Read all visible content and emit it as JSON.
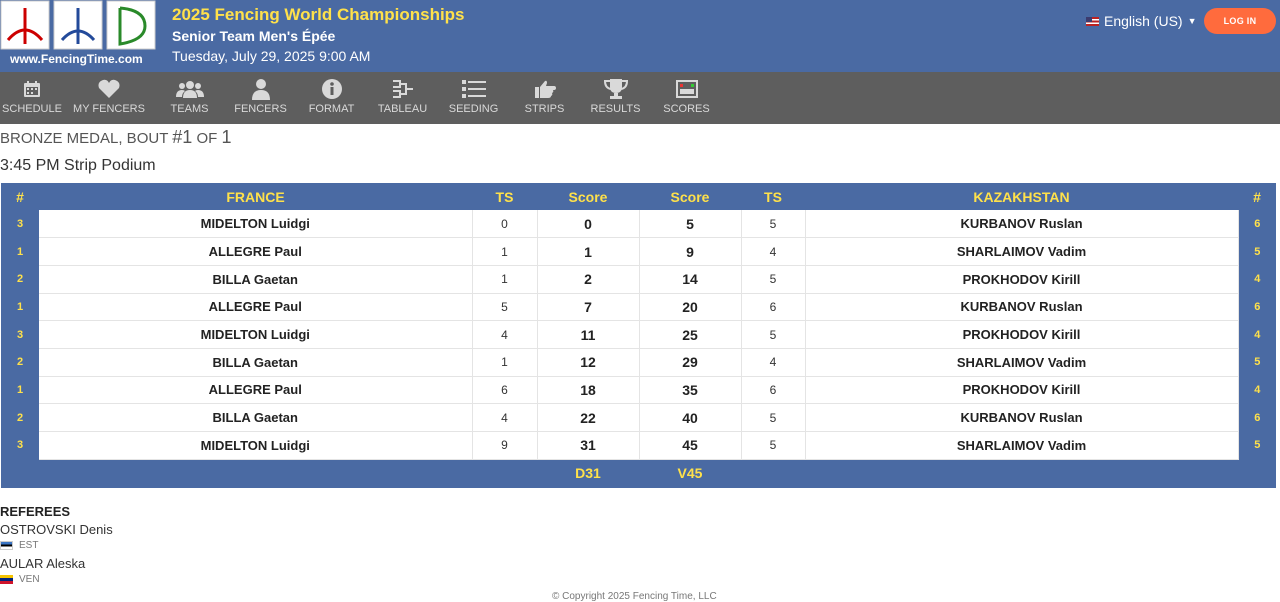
{
  "header": {
    "logo_url": "www.FencingTime.com",
    "title": "2025 Fencing World Championships",
    "subtitle": "Senior Team Men's Épée",
    "date": "Tuesday, July 29, 2025 9:00 AM",
    "language": "English (US)",
    "login_label": "LOG IN"
  },
  "nav": [
    {
      "label": "Schedule",
      "icon": "calendar-icon"
    },
    {
      "label": "My Fencers",
      "icon": "heart-icon"
    },
    {
      "label": "Teams",
      "icon": "group-icon"
    },
    {
      "label": "Fencers",
      "icon": "person-icon"
    },
    {
      "label": "Format",
      "icon": "info-icon"
    },
    {
      "label": "Tableau",
      "icon": "bracket-icon"
    },
    {
      "label": "Seeding",
      "icon": "list-icon"
    },
    {
      "label": "Strips",
      "icon": "pointing-hand-icon"
    },
    {
      "label": "Results",
      "icon": "trophy-icon"
    },
    {
      "label": "Scores",
      "icon": "scoreboard-icon"
    }
  ],
  "bout": {
    "prefix": "Bronze Medal, Bout ",
    "number": "#1",
    "of": " of ",
    "total": "1",
    "strip": "3:45 PM Strip Podium"
  },
  "table": {
    "headers": {
      "num_left": "#",
      "team_left": "FRANCE",
      "ts_left": "TS",
      "score_left": "Score",
      "score_right": "Score",
      "ts_right": "TS",
      "team_right": "KAZAKHSTAN",
      "num_right": "#"
    },
    "rows": [
      {
        "ln": "3",
        "lname": "MIDELTON Luidgi",
        "lts": "0",
        "lsc": "0",
        "rsc": "5",
        "rts": "5",
        "rname": "KURBANOV Ruslan",
        "rn": "6"
      },
      {
        "ln": "1",
        "lname": "ALLEGRE Paul",
        "lts": "1",
        "lsc": "1",
        "rsc": "9",
        "rts": "4",
        "rname": "SHARLAIMOV Vadim",
        "rn": "5"
      },
      {
        "ln": "2",
        "lname": "BILLA Gaetan",
        "lts": "1",
        "lsc": "2",
        "rsc": "14",
        "rts": "5",
        "rname": "PROKHODOV Kirill",
        "rn": "4"
      },
      {
        "ln": "1",
        "lname": "ALLEGRE Paul",
        "lts": "5",
        "lsc": "7",
        "rsc": "20",
        "rts": "6",
        "rname": "KURBANOV Ruslan",
        "rn": "6"
      },
      {
        "ln": "3",
        "lname": "MIDELTON Luidgi",
        "lts": "4",
        "lsc": "11",
        "rsc": "25",
        "rts": "5",
        "rname": "PROKHODOV Kirill",
        "rn": "4"
      },
      {
        "ln": "2",
        "lname": "BILLA Gaetan",
        "lts": "1",
        "lsc": "12",
        "rsc": "29",
        "rts": "4",
        "rname": "SHARLAIMOV Vadim",
        "rn": "5"
      },
      {
        "ln": "1",
        "lname": "ALLEGRE Paul",
        "lts": "6",
        "lsc": "18",
        "rsc": "35",
        "rts": "6",
        "rname": "PROKHODOV Kirill",
        "rn": "4"
      },
      {
        "ln": "2",
        "lname": "BILLA Gaetan",
        "lts": "4",
        "lsc": "22",
        "rsc": "40",
        "rts": "5",
        "rname": "KURBANOV Ruslan",
        "rn": "6"
      },
      {
        "ln": "3",
        "lname": "MIDELTON Luidgi",
        "lts": "9",
        "lsc": "31",
        "rsc": "45",
        "rts": "5",
        "rname": "SHARLAIMOV Vadim",
        "rn": "5"
      }
    ],
    "final_left": "D31",
    "final_right": "V45"
  },
  "referees": {
    "heading": "REFEREES",
    "list": [
      {
        "name": "OSTROVSKI Denis",
        "country": "EST"
      },
      {
        "name": "AULAR Aleska",
        "country": "VEN"
      }
    ]
  },
  "footer": {
    "copyright": "© Copyright 2025 Fencing Time, LLC"
  },
  "colors": {
    "header_bg": "#4a6aa3",
    "nav_bg": "#5e5e5e",
    "accent_yellow": "#ffe14a",
    "login_orange": "#ff6b3d"
  }
}
